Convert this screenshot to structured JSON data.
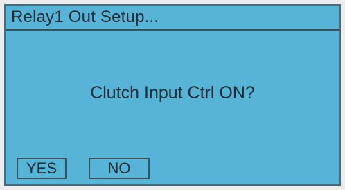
{
  "dialog": {
    "title": "Relay1 Out Setup...",
    "message": "Clutch Input Ctrl ON?",
    "yes_label": "YES",
    "no_label": "NO"
  },
  "colors": {
    "screen_background": "#56b4d6",
    "text": "#1b2a33",
    "border": "#3c4f58"
  }
}
